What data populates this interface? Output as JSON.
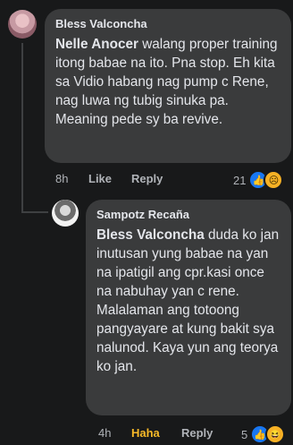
{
  "comment": {
    "author": "Bless Valconcha",
    "mention": "Nelle Anocer",
    "text": " walang proper training itong babae na ito. Pna stop. Eh kita sa Vidio habang nag pump c Rene, nag luwa ng tubig sinuka pa. Meaning pede sy ba revive.",
    "time": "8h",
    "like_label": "Like",
    "reply_label": "Reply",
    "reaction_count": "21",
    "reactions": [
      "like-icon",
      "sad-icon"
    ]
  },
  "reply": {
    "author": "Sampotz Recaña",
    "mention": "Bless Valconcha",
    "text": " duda ko jan inutusan yung babae na yan na ipatigil ang cpr.kasi once na nabuhay yan c rene. Malalaman ang totoong pangyayare at kung bakit sya nalunod. Kaya yun ang teorya ko jan.",
    "time": "4h",
    "reaction_label": "Haha",
    "reply_label": "Reply",
    "reaction_count": "5",
    "reactions": [
      "like-icon",
      "haha-icon"
    ]
  },
  "colors": {
    "background": "#18191a",
    "bubble": "#3a3b3c",
    "text": "#e4e6eb",
    "meta": "#b0b3b8",
    "like_blue": "#1877f2",
    "haha_yellow": "#f7b928"
  }
}
